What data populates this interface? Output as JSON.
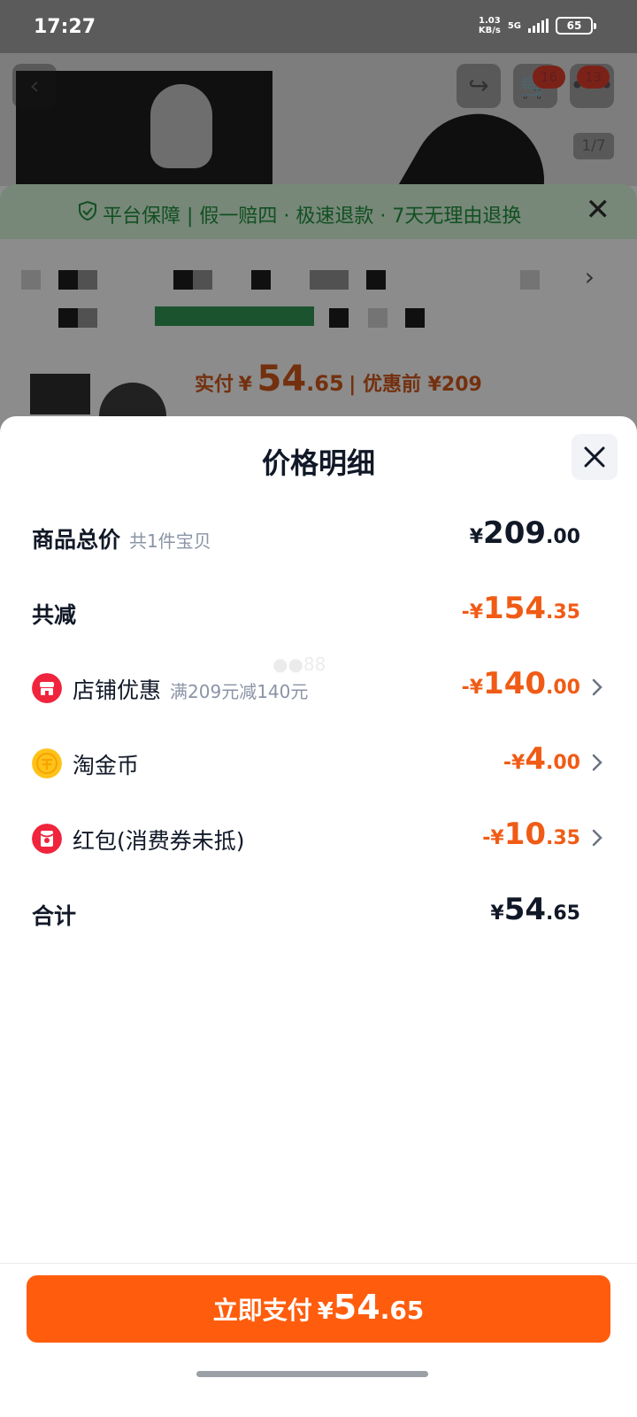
{
  "status_bar": {
    "time": "17:27",
    "net_speed_top": "1.03",
    "net_speed_bottom": "KB/s",
    "net_type": "5G",
    "battery": "65"
  },
  "background": {
    "cart_badge": "16",
    "msg_badge": "13",
    "image_indicator": "1/7",
    "guarantee_text": "平台保障 | 假一赔四 · 极速退款 · 7天无理由退换",
    "paid_label": "实付",
    "paid_currency": "¥",
    "paid_int": "54",
    "paid_dec": ".65",
    "before_discount": "优惠前 ¥209"
  },
  "sheet": {
    "title": "价格明细",
    "rows": [
      {
        "label": "商品总价",
        "sub": "共1件宝贝",
        "amount_prefix": "¥",
        "amount_int": "209",
        "amount_dec": ".00"
      },
      {
        "label": "共减",
        "sub": "",
        "amount_prefix": "-¥",
        "amount_int": "154",
        "amount_dec": ".35"
      },
      {
        "label": "店铺优惠",
        "sub": "满209元减140元",
        "amount_prefix": "-¥",
        "amount_int": "140",
        "amount_dec": ".00",
        "icon": "shop-icon"
      },
      {
        "label": "淘金币",
        "sub": "",
        "amount_prefix": "-¥",
        "amount_int": "4",
        "amount_dec": ".00",
        "icon": "gold-coin-icon"
      },
      {
        "label": "红包(消费券未抵)",
        "sub": "",
        "amount_prefix": "-¥",
        "amount_int": "10",
        "amount_dec": ".35",
        "icon": "red-packet-icon"
      },
      {
        "label": "合计",
        "sub": "",
        "amount_prefix": "¥",
        "amount_int": "54",
        "amount_dec": ".65"
      }
    ],
    "pay_button": {
      "label": "立即支付",
      "currency": "¥",
      "amount_int": "54",
      "amount_dec": ".65"
    }
  },
  "colors": {
    "accent": "#ff5d0d",
    "discount": "#f05b15",
    "text": "#111827",
    "muted": "#8a94a6"
  }
}
